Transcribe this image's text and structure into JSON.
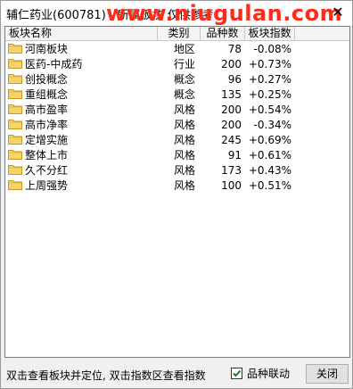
{
  "window": {
    "title": "辅仁药业(600781) - 所属板块 仅供参考",
    "watermark": "www.niugulan.com",
    "close_glyph": "✕"
  },
  "table": {
    "columns": [
      "板块名称",
      "类别",
      "品种数",
      "板块指数"
    ],
    "rows": [
      {
        "name": "河南板块",
        "type": "地区",
        "count": "78",
        "index": "-0.08%",
        "icon": "folder-icon"
      },
      {
        "name": "医药-中成药",
        "type": "行业",
        "count": "200",
        "index": "+0.73%",
        "icon": "folder-icon"
      },
      {
        "name": "创投概念",
        "type": "概念",
        "count": "96",
        "index": "+0.27%",
        "icon": "folder-icon"
      },
      {
        "name": "重组概念",
        "type": "概念",
        "count": "135",
        "index": "+0.25%",
        "icon": "folder-icon"
      },
      {
        "name": "高市盈率",
        "type": "风格",
        "count": "200",
        "index": "+0.54%",
        "icon": "folder-icon"
      },
      {
        "name": "高市净率",
        "type": "风格",
        "count": "200",
        "index": "-0.34%",
        "icon": "folder-icon"
      },
      {
        "name": "定增实施",
        "type": "风格",
        "count": "245",
        "index": "+0.69%",
        "icon": "folder-icon"
      },
      {
        "name": "整体上市",
        "type": "风格",
        "count": "91",
        "index": "+0.61%",
        "icon": "folder-icon"
      },
      {
        "name": "久不分红",
        "type": "风格",
        "count": "173",
        "index": "+0.43%",
        "icon": "folder-icon"
      },
      {
        "name": "上周强势",
        "type": "风格",
        "count": "100",
        "index": "+0.51%",
        "icon": "folder-icon"
      }
    ]
  },
  "status": {
    "hint": "双击查看板块并定位, 双击指数区查看指数",
    "checkbox_label": "品种联动",
    "checkbox_checked": true,
    "close_label": "关闭"
  },
  "colors": {
    "folder_fill": "#f7d46b",
    "folder_stroke": "#c79a1d",
    "checkmark": "#1e7b1e",
    "watermark": "#ff2a1a"
  }
}
